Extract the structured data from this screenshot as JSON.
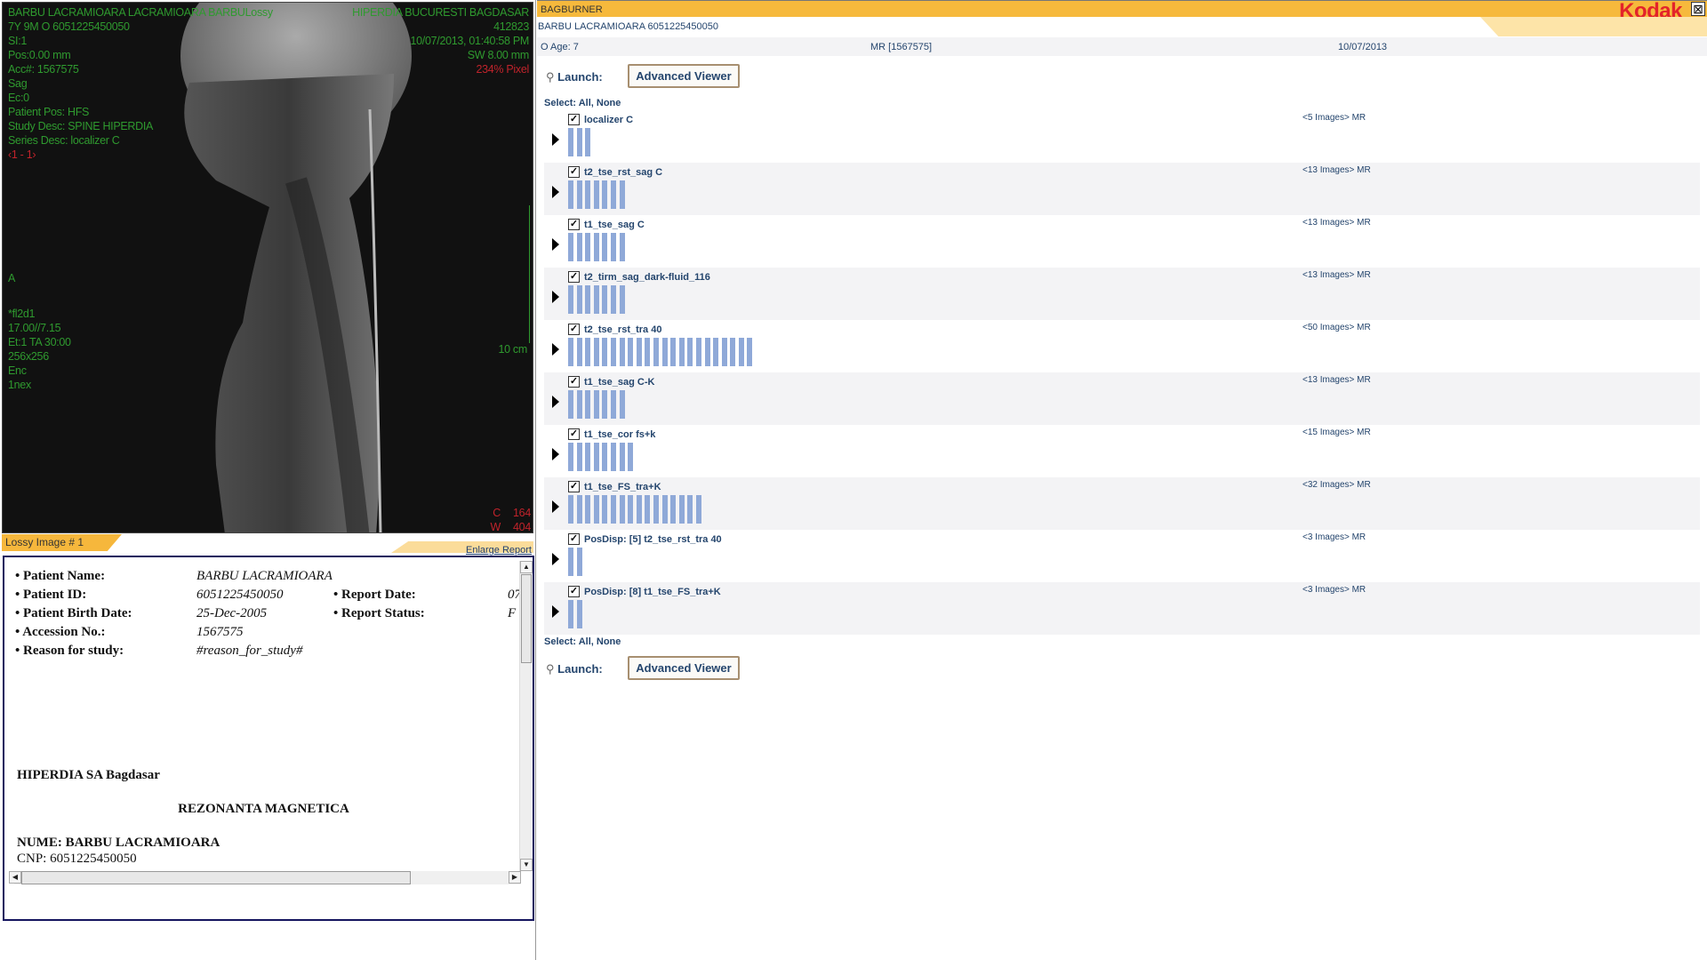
{
  "viewer": {
    "top_left": [
      "BARBU LACRAMIOARA LACRAMIOARA BARBULossy",
      "7Y 9M O 6051225450050",
      "SI:1",
      "Pos:0.00 mm",
      "Acc#: 1567575",
      "Sag",
      "Ec:0",
      "Patient Pos: HFS",
      "Study Desc: SPINE  HIPERDIA",
      "Series Desc: localizer C"
    ],
    "image_nav": "‹1 - 1›",
    "top_right": [
      "HIPERDIA BUCURESTI BAGDASAR",
      "412823",
      "10/07/2013, 01:40:58 PM",
      "SW 8.00 mm"
    ],
    "zoom": "234% Pixel",
    "orientation": "A",
    "mid_left": [
      "*fl2d1",
      "17.00//7.15",
      "Et:1 TA 30:00",
      "256x256",
      "Enc",
      "1nex"
    ],
    "scale": "10 cm",
    "center_label": "C",
    "center_value": "164",
    "width_label": "W",
    "width_value": "404"
  },
  "lossy": {
    "label": "Lossy Image # 1",
    "enlarge": "Enlarge Report"
  },
  "report": {
    "fields": [
      {
        "label": "Patient Name:",
        "value": "BARBU LACRAMIOARA"
      },
      {
        "label": "Patient ID:",
        "value": "6051225450050"
      },
      {
        "label": "Patient Birth Date:",
        "value": "25-Dec-2005"
      },
      {
        "label": "Accession No.:",
        "value": "1567575"
      },
      {
        "label": "Reason for study:",
        "value": "#reason_for_study#"
      }
    ],
    "right_fields": [
      {
        "label": "Report Date:",
        "value": "07"
      },
      {
        "label": "Report Status:",
        "value": "F"
      }
    ],
    "institution": "HIPERDIA SA Bagdasar",
    "title": "REZONANTA MAGNETICA",
    "name_line": "NUME: BARBU LACRAMIOARA",
    "cnp_line": "CNP: 6051225450050"
  },
  "header": {
    "app": "BAGBURNER",
    "brand": "Kodak",
    "close": "⊠"
  },
  "patient": {
    "line": "BARBU LACRAMIOARA  6051225450050",
    "age": "O  Age: 7",
    "study": "MR [1567575]",
    "date": "10/07/2013"
  },
  "launch": {
    "label": "Launch:",
    "button": "Advanced Viewer"
  },
  "select": "Select: All, None",
  "series": [
    {
      "name": "localizer C",
      "count": "<5 Images> MR",
      "bars": 3,
      "checked": true
    },
    {
      "name": "t2_tse_rst_sag C",
      "count": "<13 Images> MR",
      "bars": 7,
      "checked": true
    },
    {
      "name": "t1_tse_sag C",
      "count": "<13 Images> MR",
      "bars": 7,
      "checked": true
    },
    {
      "name": "t2_tirm_sag_dark-fluid_116",
      "count": "<13 Images> MR",
      "bars": 7,
      "checked": true
    },
    {
      "name": "t2_tse_rst_tra 40",
      "count": "<50 Images> MR",
      "bars": 22,
      "checked": true
    },
    {
      "name": "t1_tse_sag C-K",
      "count": "<13 Images> MR",
      "bars": 7,
      "checked": true
    },
    {
      "name": "t1_tse_cor fs+k",
      "count": "<15 Images> MR",
      "bars": 8,
      "checked": true
    },
    {
      "name": "t1_tse_FS_tra+K",
      "count": "<32 Images> MR",
      "bars": 16,
      "checked": true
    },
    {
      "name": "PosDisp: [5] t2_tse_rst_tra 40",
      "count": "<3 Images> MR",
      "bars": 2,
      "checked": true
    },
    {
      "name": "PosDisp: [8] t1_tse_FS_tra+K",
      "count": "<3 Images> MR",
      "bars": 2,
      "checked": true
    }
  ]
}
